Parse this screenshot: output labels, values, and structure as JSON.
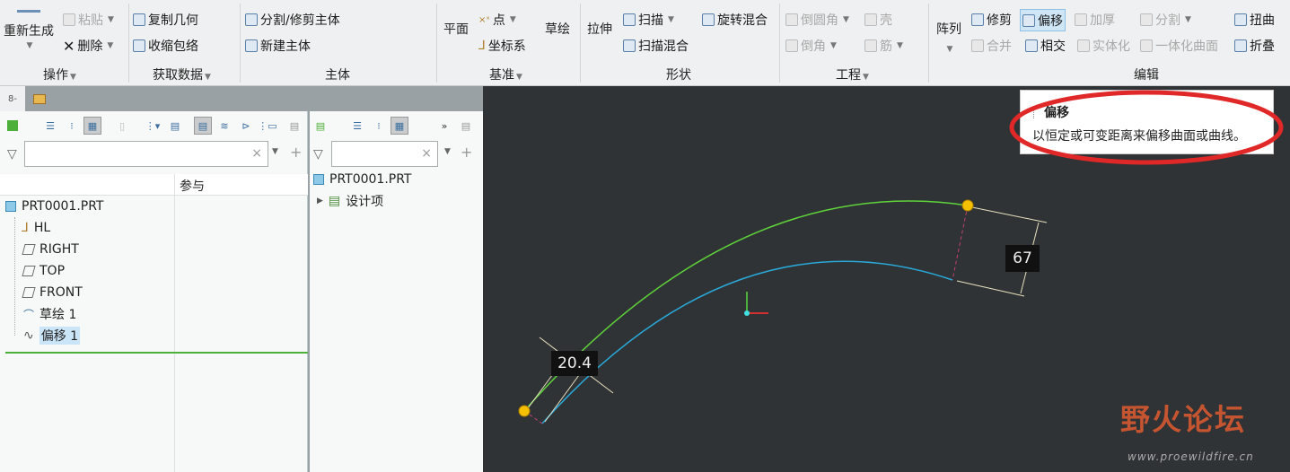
{
  "ribbon": {
    "regenerate": "重新生成",
    "paste": "粘贴",
    "delete": "删除",
    "copy_geom": "复制几何",
    "shrinkwrap": "收缩包络",
    "split_trim": "分割/修剪主体",
    "new_body": "新建主体",
    "plane": "平面",
    "point": "点",
    "csys": "坐标系",
    "sketch": "草绘",
    "extrude": "拉伸",
    "sweep": "扫描",
    "swept_blend": "扫描混合",
    "rot_blend": "旋转混合",
    "round": "倒圆角",
    "shell": "壳",
    "chamfer": "倒角",
    "rib": "筋",
    "pattern": "阵列",
    "trim": "修剪",
    "offset": "偏移",
    "thicken": "加厚",
    "split": "分割",
    "warp": "扭曲",
    "merge": "合并",
    "intersect": "相交",
    "solidify": "实体化",
    "unify": "一体化曲面",
    "fold": "折叠",
    "groups": {
      "ops": "操作",
      "getdata": "获取数据",
      "body": "主体",
      "datum": "基准",
      "shapes": "形状",
      "eng": "工程",
      "edit": "编辑"
    }
  },
  "left_panel": {
    "column_header": "参与",
    "filter_value": "",
    "tree": [
      {
        "label": "PRT0001.PRT"
      },
      {
        "label": "HL"
      },
      {
        "label": "RIGHT"
      },
      {
        "label": "TOP"
      },
      {
        "label": "FRONT"
      },
      {
        "label": "草绘 1"
      },
      {
        "label": "偏移 1"
      }
    ]
  },
  "mid_panel": {
    "filter_value": "",
    "root": "PRT0001.PRT",
    "child": "设计项"
  },
  "tooltip": {
    "title": "偏移",
    "text": "以恒定或可变距离来偏移曲面或曲线。"
  },
  "viewport": {
    "dim_offset": "20.4",
    "dim_length": "67"
  },
  "watermark": {
    "title": "野火论坛",
    "url": "www.proewildfire.cn"
  },
  "colors": {
    "viewport_bg": "#2f3335",
    "curve_green": "#5fd33a",
    "curve_blue": "#2aa8d8",
    "annotation": "#e02828"
  }
}
